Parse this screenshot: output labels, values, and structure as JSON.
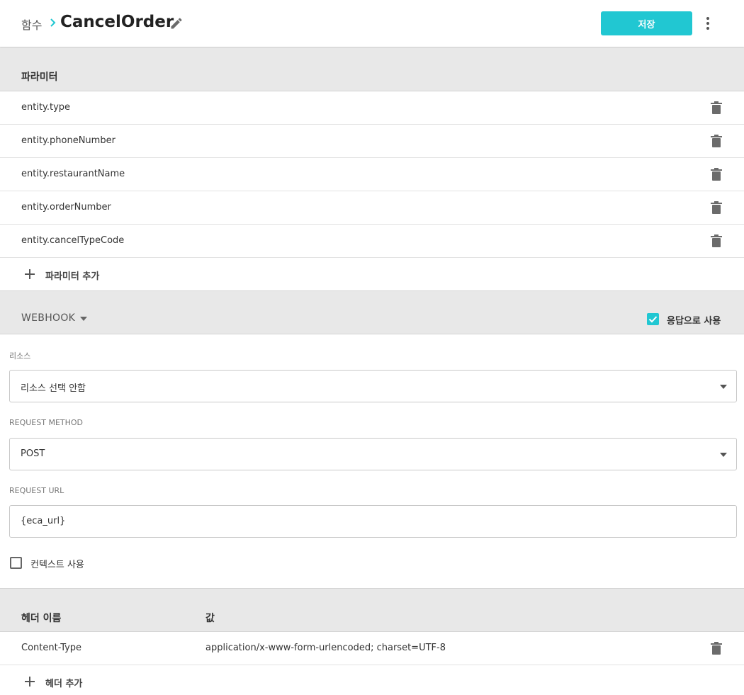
{
  "header": {
    "breadcrumb_parent": "함수",
    "title": "CancelOrder",
    "save_label": "저장"
  },
  "parameters": {
    "section_title": "파라미터",
    "items": [
      {
        "label": "entity.type"
      },
      {
        "label": "entity.phoneNumber"
      },
      {
        "label": "entity.restaurantName"
      },
      {
        "label": "entity.orderNumber"
      },
      {
        "label": "entity.cancelTypeCode"
      }
    ],
    "add_label": "파라미터 추가"
  },
  "webhook": {
    "section_title": "WEBHOOK",
    "use_as_response_label": "응답으로 사용",
    "use_as_response_checked": true,
    "resource_label": "리소스",
    "resource_value": "리소스 선택 안함",
    "method_label": "REQUEST METHOD",
    "method_value": "POST",
    "url_label": "REQUEST URL",
    "url_value": "{eca_url}",
    "use_context_label": "컨텍스트 사용",
    "use_context_checked": false
  },
  "headers": {
    "name_col": "헤더 이름",
    "value_col": "값",
    "rows": [
      {
        "name": "Content-Type",
        "value": "application/x-www-form-urlencoded; charset=UTF-8"
      }
    ],
    "add_label": "헤더 추가"
  },
  "colors": {
    "accent": "#21c7d2",
    "section_bg": "#e8e8e8",
    "icon": "#6b6b6b"
  },
  "icons": {
    "edit": "pencil-icon",
    "more": "more-vert-icon",
    "delete": "trash-icon",
    "add": "plus-icon",
    "dropdown": "caret-down-icon",
    "breadcrumb_separator": "chevron-right-icon"
  }
}
